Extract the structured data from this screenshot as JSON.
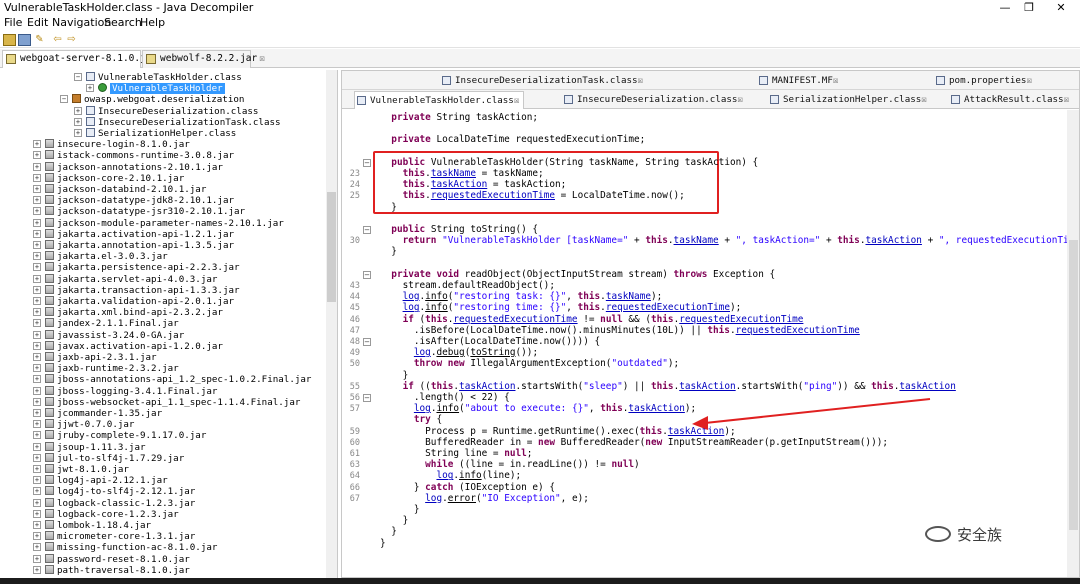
{
  "window": {
    "title": "VulnerableTaskHolder.class - Java Decompiler",
    "controls": [
      "—",
      "❐",
      "✕"
    ]
  },
  "menu": [
    "File",
    "Edit",
    "Navigation",
    "Search",
    "Help"
  ],
  "jar_tabs": [
    {
      "label": "webgoat-server-8.1.0.jar",
      "close": "☒"
    },
    {
      "label": "webwolf-8.2.2.jar",
      "close": "☒"
    }
  ],
  "tree": [
    {
      "indent": 74,
      "exp": "−",
      "icon": "cls",
      "label": "VulnerableTaskHolder.class"
    },
    {
      "indent": 86,
      "exp": "+",
      "icon": "clsg",
      "label": "VulnerableTaskHolder",
      "selected": true
    },
    {
      "indent": 60,
      "exp": "−",
      "icon": "pkg",
      "label": "owasp.webgoat.deserialization"
    },
    {
      "indent": 74,
      "exp": "+",
      "icon": "cls",
      "label": "InsecureDeserialization.class"
    },
    {
      "indent": 74,
      "exp": "+",
      "icon": "cls",
      "label": "InsecureDeserializationTask.class"
    },
    {
      "indent": 74,
      "exp": "+",
      "icon": "cls",
      "label": "SerializationHelper.class"
    },
    {
      "indent": 33,
      "exp": "+",
      "icon": "jar",
      "label": "insecure-login-8.1.0.jar"
    },
    {
      "indent": 33,
      "exp": "+",
      "icon": "jar",
      "label": "istack-commons-runtime-3.0.8.jar"
    },
    {
      "indent": 33,
      "exp": "+",
      "icon": "jar",
      "label": "jackson-annotations-2.10.1.jar"
    },
    {
      "indent": 33,
      "exp": "+",
      "icon": "jar",
      "label": "jackson-core-2.10.1.jar"
    },
    {
      "indent": 33,
      "exp": "+",
      "icon": "jar",
      "label": "jackson-databind-2.10.1.jar"
    },
    {
      "indent": 33,
      "exp": "+",
      "icon": "jar",
      "label": "jackson-datatype-jdk8-2.10.1.jar"
    },
    {
      "indent": 33,
      "exp": "+",
      "icon": "jar",
      "label": "jackson-datatype-jsr310-2.10.1.jar"
    },
    {
      "indent": 33,
      "exp": "+",
      "icon": "jar",
      "label": "jackson-module-parameter-names-2.10.1.jar"
    },
    {
      "indent": 33,
      "exp": "+",
      "icon": "jar",
      "label": "jakarta.activation-api-1.2.1.jar"
    },
    {
      "indent": 33,
      "exp": "+",
      "icon": "jar",
      "label": "jakarta.annotation-api-1.3.5.jar"
    },
    {
      "indent": 33,
      "exp": "+",
      "icon": "jar",
      "label": "jakarta.el-3.0.3.jar"
    },
    {
      "indent": 33,
      "exp": "+",
      "icon": "jar",
      "label": "jakarta.persistence-api-2.2.3.jar"
    },
    {
      "indent": 33,
      "exp": "+",
      "icon": "jar",
      "label": "jakarta.servlet-api-4.0.3.jar"
    },
    {
      "indent": 33,
      "exp": "+",
      "icon": "jar",
      "label": "jakarta.transaction-api-1.3.3.jar"
    },
    {
      "indent": 33,
      "exp": "+",
      "icon": "jar",
      "label": "jakarta.validation-api-2.0.1.jar"
    },
    {
      "indent": 33,
      "exp": "+",
      "icon": "jar",
      "label": "jakarta.xml.bind-api-2.3.2.jar"
    },
    {
      "indent": 33,
      "exp": "+",
      "icon": "jar",
      "label": "jandex-2.1.1.Final.jar"
    },
    {
      "indent": 33,
      "exp": "+",
      "icon": "jar",
      "label": "javassist-3.24.0-GA.jar"
    },
    {
      "indent": 33,
      "exp": "+",
      "icon": "jar",
      "label": "javax.activation-api-1.2.0.jar"
    },
    {
      "indent": 33,
      "exp": "+",
      "icon": "jar",
      "label": "jaxb-api-2.3.1.jar"
    },
    {
      "indent": 33,
      "exp": "+",
      "icon": "jar",
      "label": "jaxb-runtime-2.3.2.jar"
    },
    {
      "indent": 33,
      "exp": "+",
      "icon": "jar",
      "label": "jboss-annotations-api_1.2_spec-1.0.2.Final.jar"
    },
    {
      "indent": 33,
      "exp": "+",
      "icon": "jar",
      "label": "jboss-logging-3.4.1.Final.jar"
    },
    {
      "indent": 33,
      "exp": "+",
      "icon": "jar",
      "label": "jboss-websocket-api_1.1_spec-1.1.4.Final.jar"
    },
    {
      "indent": 33,
      "exp": "+",
      "icon": "jar",
      "label": "jcommander-1.35.jar"
    },
    {
      "indent": 33,
      "exp": "+",
      "icon": "jar",
      "label": "jjwt-0.7.0.jar"
    },
    {
      "indent": 33,
      "exp": "+",
      "icon": "jar",
      "label": "jruby-complete-9.1.17.0.jar"
    },
    {
      "indent": 33,
      "exp": "+",
      "icon": "jar",
      "label": "jsoup-1.11.3.jar"
    },
    {
      "indent": 33,
      "exp": "+",
      "icon": "jar",
      "label": "jul-to-slf4j-1.7.29.jar"
    },
    {
      "indent": 33,
      "exp": "+",
      "icon": "jar",
      "label": "jwt-8.1.0.jar"
    },
    {
      "indent": 33,
      "exp": "+",
      "icon": "jar",
      "label": "log4j-api-2.12.1.jar"
    },
    {
      "indent": 33,
      "exp": "+",
      "icon": "jar",
      "label": "log4j-to-slf4j-2.12.1.jar"
    },
    {
      "indent": 33,
      "exp": "+",
      "icon": "jar",
      "label": "logback-classic-1.2.3.jar"
    },
    {
      "indent": 33,
      "exp": "+",
      "icon": "jar",
      "label": "logback-core-1.2.3.jar"
    },
    {
      "indent": 33,
      "exp": "+",
      "icon": "jar",
      "label": "lombok-1.18.4.jar"
    },
    {
      "indent": 33,
      "exp": "+",
      "icon": "jar",
      "label": "micrometer-core-1.3.1.jar"
    },
    {
      "indent": 33,
      "exp": "+",
      "icon": "jar",
      "label": "missing-function-ac-8.1.0.jar"
    },
    {
      "indent": 33,
      "exp": "+",
      "icon": "jar",
      "label": "password-reset-8.1.0.jar"
    },
    {
      "indent": 33,
      "exp": "+",
      "icon": "jar",
      "label": "path-traversal-8.1.0.jar"
    }
  ],
  "editor_tabs_row1": [
    {
      "label": "InsecureDeserializationTask.class",
      "close": "☒"
    },
    {
      "label": "MANIFEST.MF",
      "close": "☒"
    },
    {
      "label": "pom.properties",
      "close": "☒"
    }
  ],
  "editor_tabs_row2": [
    {
      "label": "VulnerableTaskHolder.class",
      "close": "☒",
      "active": true
    },
    {
      "label": "InsecureDeserialization.class",
      "close": "☒"
    },
    {
      "label": "SerializationHelper.class",
      "close": "☒"
    },
    {
      "label": "AttackResult.class",
      "close": "☒"
    }
  ],
  "code_lines": [
    {
      "ln": "",
      "fold": "",
      "html": "  <span class='kw'>private</span> String taskAction;"
    },
    {
      "ln": "",
      "fold": "",
      "html": ""
    },
    {
      "ln": "",
      "fold": "",
      "html": "  <span class='kw'>private</span> LocalDateTime requestedExecutionTime;"
    },
    {
      "ln": "",
      "fold": "",
      "html": ""
    },
    {
      "ln": "",
      "fold": "⊖",
      "html": "  <span class='kw'>public</span> VulnerableTaskHolder(String taskName, String taskAction) {"
    },
    {
      "ln": "23",
      "fold": "",
      "html": "    <span class='kw'>this</span>.<span class='fld'>taskName</span> = taskName;"
    },
    {
      "ln": "24",
      "fold": "",
      "html": "    <span class='kw'>this</span>.<span class='fld'>taskAction</span> = taskAction;"
    },
    {
      "ln": "25",
      "fold": "",
      "html": "    <span class='kw'>this</span>.<span class='fld'>requestedExecutionTime</span> = LocalDateTime.now();"
    },
    {
      "ln": "",
      "fold": "",
      "html": "  }"
    },
    {
      "ln": "",
      "fold": "",
      "html": ""
    },
    {
      "ln": "",
      "fold": "⊖",
      "html": "  <span class='kw'>public</span> String toString() {"
    },
    {
      "ln": "30",
      "fold": "",
      "html": "    <span class='kw'>return</span> <span class='str'>\"VulnerableTaskHolder [taskName=\"</span> + <span class='kw'>this</span>.<span class='fld'>taskName</span> + <span class='str'>\", taskAction=\"</span> + <span class='kw'>this</span>.<span class='fld'>taskAction</span> + <span class='str'>\", requestedExecutionTime=\"</span> + <span class='kw'>this</span>.<span class='fld'>r</span>"
    },
    {
      "ln": "",
      "fold": "",
      "html": "  }"
    },
    {
      "ln": "",
      "fold": "",
      "html": ""
    },
    {
      "ln": "",
      "fold": "⊖",
      "html": "  <span class='kw'>private void</span> readObject(ObjectInputStream stream) <span class='kw'>throws</span> Exception {"
    },
    {
      "ln": "43",
      "fold": "",
      "html": "    stream.defaultReadObject();"
    },
    {
      "ln": "44",
      "fold": "",
      "html": "    <span class='fld'>log</span>.<span class='mth'>info</span>(<span class='str'>\"restoring task: {}\"</span>, <span class='kw'>this</span>.<span class='fld'>taskName</span>);"
    },
    {
      "ln": "45",
      "fold": "",
      "html": "    <span class='fld'>log</span>.<span class='mth'>info</span>(<span class='str'>\"restoring time: {}\"</span>, <span class='kw'>this</span>.<span class='fld'>requestedExecutionTime</span>);"
    },
    {
      "ln": "46",
      "fold": "",
      "html": "    <span class='kw'>if</span> (<span class='kw'>this</span>.<span class='fld'>requestedExecutionTime</span> != <span class='kw'>null</span> &amp;&amp; (<span class='kw'>this</span>.<span class='fld'>requestedExecutionTime</span>"
    },
    {
      "ln": "47",
      "fold": "",
      "html": "      .isBefore(LocalDateTime.now().minusMinutes(10L)) || <span class='kw'>this</span>.<span class='fld'>requestedExecutionTime</span>"
    },
    {
      "ln": "48",
      "fold": "⊖",
      "html": "      .isAfter(LocalDateTime.now()))) {"
    },
    {
      "ln": "49",
      "fold": "",
      "html": "      <span class='fld'>log</span>.<span class='mth'>debug</span>(<span class='mth'>toString</span>());"
    },
    {
      "ln": "50",
      "fold": "",
      "html": "      <span class='kw'>throw new</span> IllegalArgumentException(<span class='str'>\"outdated\"</span>);"
    },
    {
      "ln": "",
      "fold": "",
      "html": "    }"
    },
    {
      "ln": "55",
      "fold": "",
      "html": "    <span class='kw'>if</span> ((<span class='kw'>this</span>.<span class='fld'>taskAction</span>.startsWith(<span class='str'>\"sleep\"</span>) || <span class='kw'>this</span>.<span class='fld'>taskAction</span>.startsWith(<span class='str'>\"ping\"</span>)) &amp;&amp; <span class='kw'>this</span>.<span class='fld'>taskAction</span>"
    },
    {
      "ln": "56",
      "fold": "⊖",
      "html": "      .length() &lt; 22) {"
    },
    {
      "ln": "57",
      "fold": "",
      "html": "      <span class='fld'>log</span>.<span class='mth'>info</span>(<span class='str'>\"about to execute: {}\"</span>, <span class='kw'>this</span>.<span class='fld'>taskAction</span>);"
    },
    {
      "ln": "",
      "fold": "",
      "html": "      <span class='kw'>try</span> {"
    },
    {
      "ln": "59",
      "fold": "",
      "html": "        Process p = Runtime.getRuntime().exec(<span class='kw'>this</span>.<span class='fld'>taskAction</span>);"
    },
    {
      "ln": "60",
      "fold": "",
      "html": "        BufferedReader in = <span class='kw'>new</span> BufferedReader(<span class='kw'>new</span> InputStreamReader(p.getInputStream()));"
    },
    {
      "ln": "61",
      "fold": "",
      "html": "        String line = <span class='kw'>null</span>;"
    },
    {
      "ln": "63",
      "fold": "",
      "html": "        <span class='kw'>while</span> ((line = in.readLine()) != <span class='kw'>null</span>)"
    },
    {
      "ln": "64",
      "fold": "",
      "html": "          <span class='fld'>log</span>.<span class='mth'>info</span>(line);"
    },
    {
      "ln": "66",
      "fold": "",
      "html": "      } <span class='kw'>catch</span> (IOException e) {"
    },
    {
      "ln": "67",
      "fold": "",
      "html": "        <span class='fld'>log</span>.<span class='mth'>error</span>(<span class='str'>\"IO Exception\"</span>, e);"
    },
    {
      "ln": "",
      "fold": "",
      "html": "      }"
    },
    {
      "ln": "",
      "fold": "",
      "html": "    }"
    },
    {
      "ln": "",
      "fold": "",
      "html": "  }"
    },
    {
      "ln": "",
      "fold": "",
      "html": "}"
    }
  ],
  "watermark": "安全族"
}
